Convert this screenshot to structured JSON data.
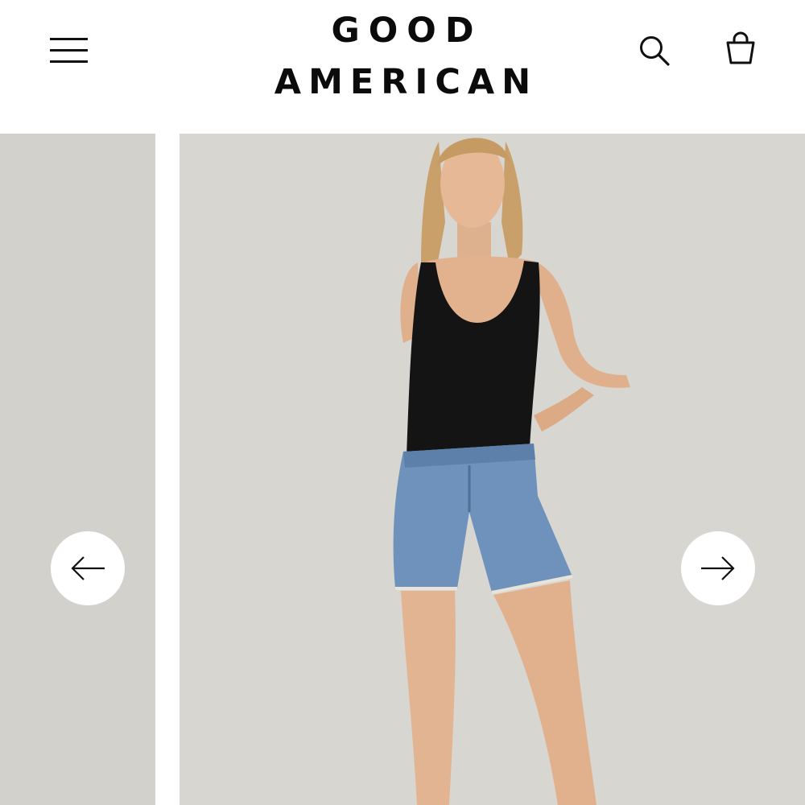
{
  "header": {
    "logo_line1": "GOOD",
    "logo_line2": "AMERICAN",
    "menu_icon": "hamburger-menu-icon",
    "search_icon": "search-icon",
    "bag_icon": "shopping-bag-icon"
  },
  "carousel": {
    "prev_icon": "arrow-left-icon",
    "next_icon": "arrow-right-icon",
    "product_image": "model-wearing-black-tank-bodysuit-and-denim-cutoff-shorts"
  },
  "colors": {
    "text": "#0b0b0b",
    "background": "#ffffff",
    "photo_backdrop": "#d7d6d1",
    "top": "#141414",
    "denim": "#6f92bc",
    "skin": "#e3b491",
    "hair": "#c9a06a"
  }
}
